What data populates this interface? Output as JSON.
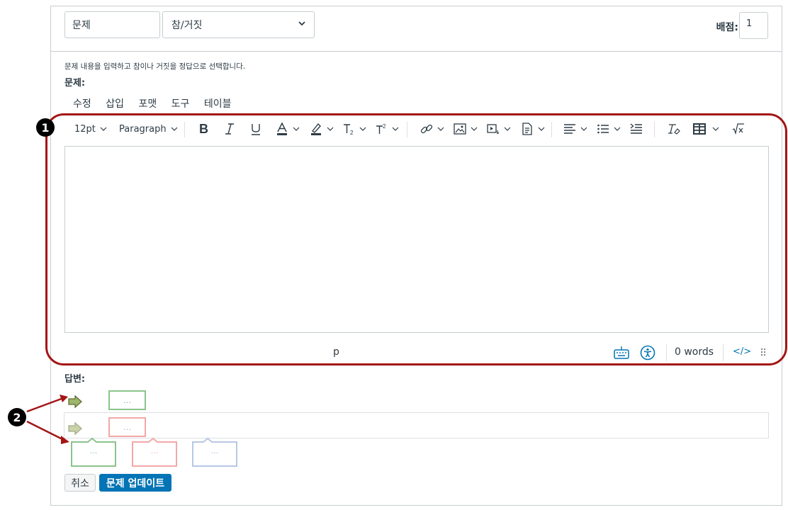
{
  "header": {
    "title_value": "문제",
    "type_selected": "참/거짓",
    "points_label": "배점:",
    "points_value": "1"
  },
  "instruction": "문제 내용을 입력하고 참이나 거짓을 정답으로 선택합니다.",
  "question_label": "문제:",
  "menubar": [
    "수정",
    "삽입",
    "포맷",
    "도구",
    "테이블"
  ],
  "toolbar": {
    "font_size": "12pt",
    "block_format": "Paragraph",
    "icons": [
      "bold-icon",
      "italic-icon",
      "underline-icon",
      "text-color-icon",
      "highlight-icon",
      "subscript-icon",
      "superscript-icon",
      "link-icon",
      "image-icon",
      "media-icon",
      "document-icon",
      "align-icon",
      "list-icon",
      "indent-icon",
      "clear-format-icon",
      "table-icon",
      "equation-icon"
    ]
  },
  "statusbar": {
    "path": "p",
    "word_count": "0 words",
    "html_toggle": "</>"
  },
  "callouts": [
    "1",
    "2"
  ],
  "answers_label": "답변:",
  "answer_placeholder": "...",
  "colors": {
    "callout_red": "#a31515",
    "correct_green": "#8bc48b",
    "wrong_red": "#f2a8a8",
    "neutral_blue": "#b8c7e6",
    "primary_blue": "#0374b5",
    "arrow_green": "#9fb56b"
  },
  "buttons": {
    "cancel": "취소",
    "update": "문제 업데이트"
  }
}
